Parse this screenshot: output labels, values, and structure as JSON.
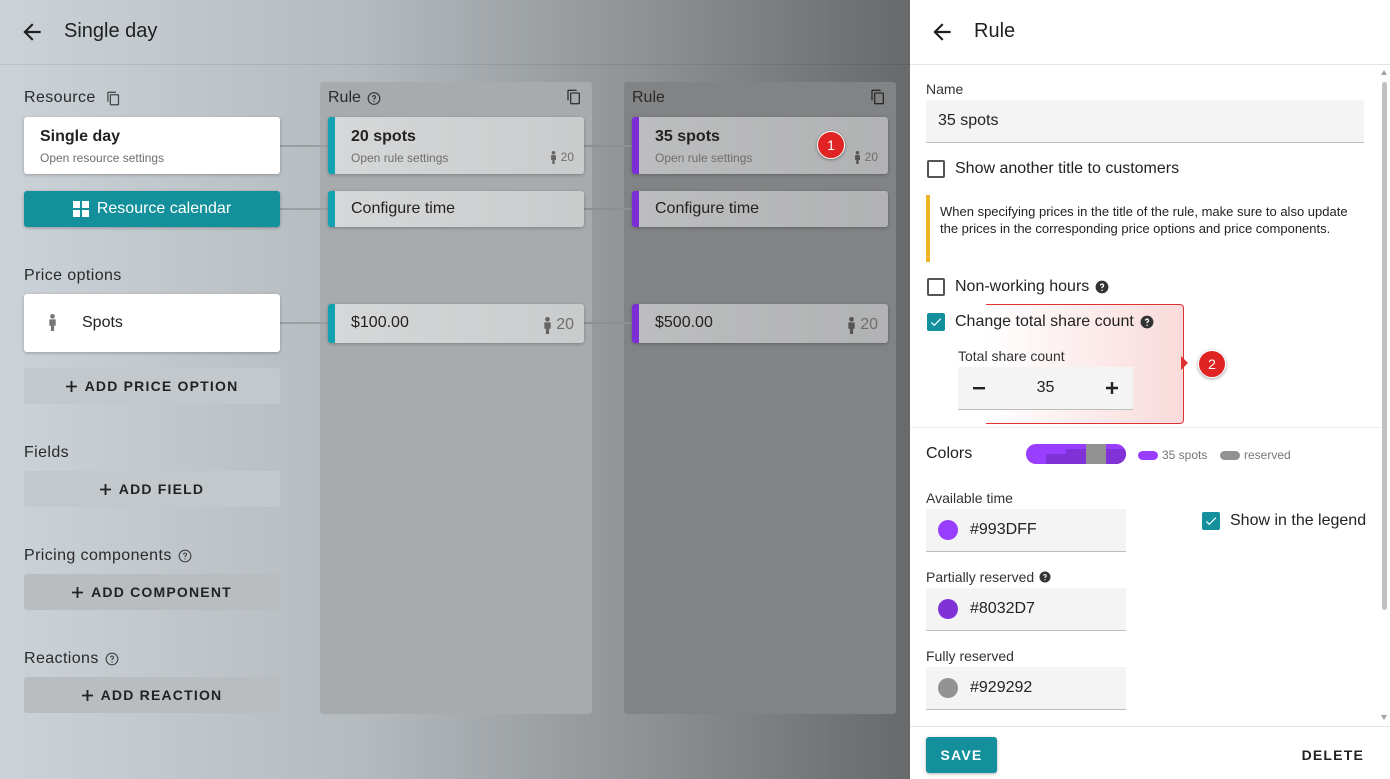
{
  "page": {
    "title": "Single day"
  },
  "resource": {
    "header": "Resource",
    "card_title": "Single day",
    "card_subtitle": "Open resource settings",
    "calendar_button": "Resource calendar"
  },
  "rules": [
    {
      "header": "Rule",
      "title": "20 spots",
      "subtitle": "Open rule settings",
      "count": "20",
      "configure": "Configure time",
      "price": "$100.00",
      "price_count": "20",
      "stripe": "#12a2b0"
    },
    {
      "header": "Rule",
      "title": "35 spots",
      "subtitle": "Open rule settings",
      "count": "20",
      "configure": "Configure time",
      "price": "$500.00",
      "price_count": "20",
      "stripe": "#7c2ed6"
    }
  ],
  "price_options": {
    "header": "Price options",
    "item": "Spots",
    "add_label": "ADD PRICE OPTION"
  },
  "fields": {
    "header": "Fields",
    "add_label": "ADD FIELD"
  },
  "pricing_components": {
    "header": "Pricing components",
    "add_label": "ADD COMPONENT"
  },
  "reactions": {
    "header": "Reactions",
    "add_label": "ADD REACTION"
  },
  "annotations": {
    "one": "1",
    "two": "2"
  },
  "panel": {
    "title": "Rule",
    "name_label": "Name",
    "name_value": "35 spots",
    "show_title_label": "Show another title to customers",
    "notice": "When specifying prices in the title of the rule, make sure to also update the prices in the corresponding price options and price components.",
    "non_working_label": "Non-working hours",
    "change_share_label": "Change total share count",
    "total_share_label": "Total share count",
    "total_share_value": "35",
    "colors_label": "Colors",
    "legend_rule": "35 spots",
    "legend_reserved": "reserved",
    "available_label": "Available time",
    "available_value": "#993DFF",
    "show_legend_label": "Show in the legend",
    "partial_label": "Partially reserved",
    "partial_value": "#8032D7",
    "full_label": "Fully reserved",
    "full_value": "#929292",
    "save_label": "SAVE",
    "delete_label": "DELETE"
  },
  "colors": {
    "available": "#993DFF",
    "partial": "#8032D7",
    "full": "#929292",
    "teal": "#13909b"
  }
}
